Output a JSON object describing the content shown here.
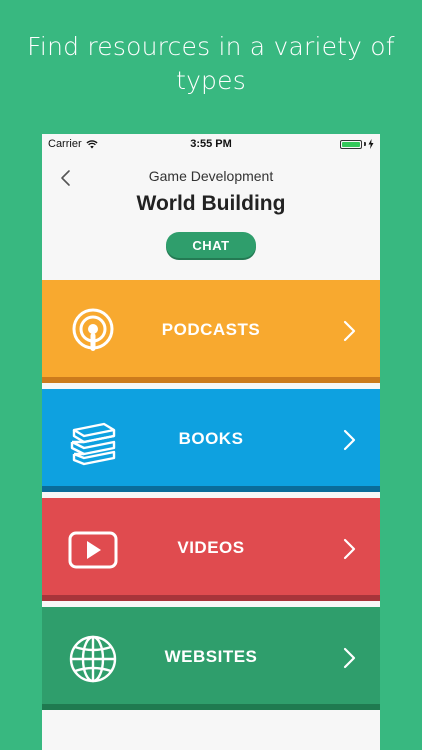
{
  "promo": {
    "line1": "Find resources in a variety of",
    "line2": "types"
  },
  "status_bar": {
    "carrier": "Carrier",
    "time": "3:55 PM",
    "battery_level": 1.0
  },
  "header": {
    "subtitle": "Game Development",
    "title": "World Building",
    "chat_label": "CHAT"
  },
  "categories": [
    {
      "label": "PODCASTS",
      "icon": "podcast-icon",
      "color": "#f8a92f"
    },
    {
      "label": "BOOKS",
      "icon": "books-icon",
      "color": "#0ea1e0"
    },
    {
      "label": "VIDEOS",
      "icon": "video-play-icon",
      "color": "#e04b4f"
    },
    {
      "label": "WEBSITES",
      "icon": "globe-icon",
      "color": "#2f9e6c"
    }
  ],
  "colors": {
    "background": "#38b880",
    "accent": "#2f9e6c"
  }
}
